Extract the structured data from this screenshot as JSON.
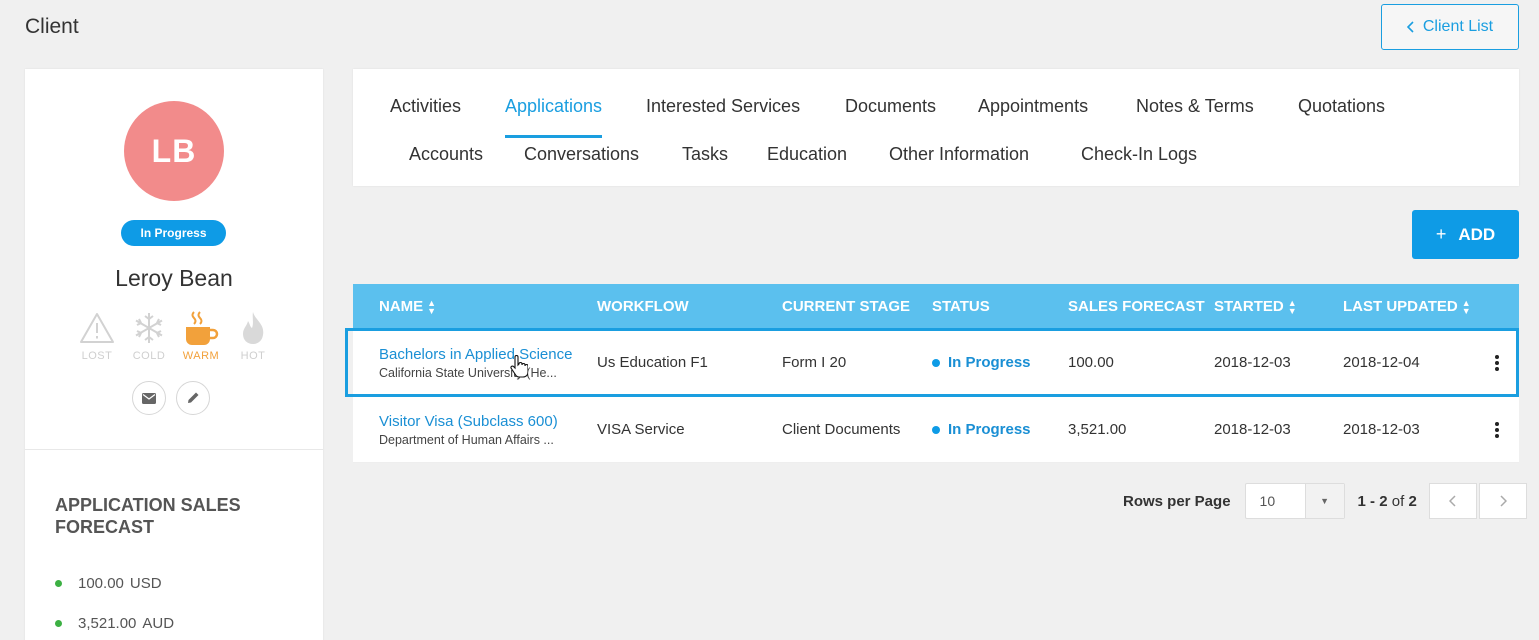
{
  "header": {
    "title": "Client",
    "client_list_label": "Client List"
  },
  "profile": {
    "initials": "LB",
    "status": "In Progress",
    "name": "Leroy Bean",
    "temperatures": [
      {
        "label": "LOST",
        "icon": "warning-icon",
        "active": false
      },
      {
        "label": "COLD",
        "icon": "snowflake-icon",
        "active": false
      },
      {
        "label": "WARM",
        "icon": "coffee-icon",
        "active": true
      },
      {
        "label": "HOT",
        "icon": "flame-icon",
        "active": false
      }
    ],
    "accent_color": "#f28b8b"
  },
  "forecast": {
    "title": "APPLICATION SALES FORECAST",
    "items": [
      {
        "amount": "100.00",
        "currency": "USD"
      },
      {
        "amount": "3,521.00",
        "currency": "AUD"
      }
    ]
  },
  "tabs": [
    "Activities",
    "Applications",
    "Interested Services",
    "Documents",
    "Appointments",
    "Notes & Terms",
    "Quotations",
    "Accounts",
    "Conversations",
    "Tasks",
    "Education",
    "Other Information",
    "Check-In Logs"
  ],
  "active_tab": "Applications",
  "add_label": "ADD",
  "table": {
    "columns": [
      "NAME",
      "WORKFLOW",
      "CURRENT STAGE",
      "STATUS",
      "SALES FORECAST",
      "STARTED",
      "LAST UPDATED"
    ],
    "rows": [
      {
        "name": "Bachelors in Applied Science",
        "institution": "California State University (He...",
        "workflow": "Us Education F1",
        "stage": "Form I 20",
        "status": "In Progress",
        "forecast": "100.00",
        "started": "2018-12-03",
        "updated": "2018-12-04"
      },
      {
        "name": "Visitor Visa (Subclass 600)",
        "institution": "Department of Human Affairs ...",
        "workflow": "VISA Service",
        "stage": "Client Documents",
        "status": "In Progress",
        "forecast": "3,521.00",
        "started": "2018-12-03",
        "updated": "2018-12-03"
      }
    ]
  },
  "pager": {
    "rows_label": "Rows per Page",
    "rows_value": "10",
    "range_start": "1",
    "range_end": "2",
    "of": "of",
    "total": "2"
  },
  "colors": {
    "primary": "#0e9be6",
    "header_bg": "#5bc0ee",
    "link": "#1a8fd4",
    "warm": "#f2a13b"
  }
}
